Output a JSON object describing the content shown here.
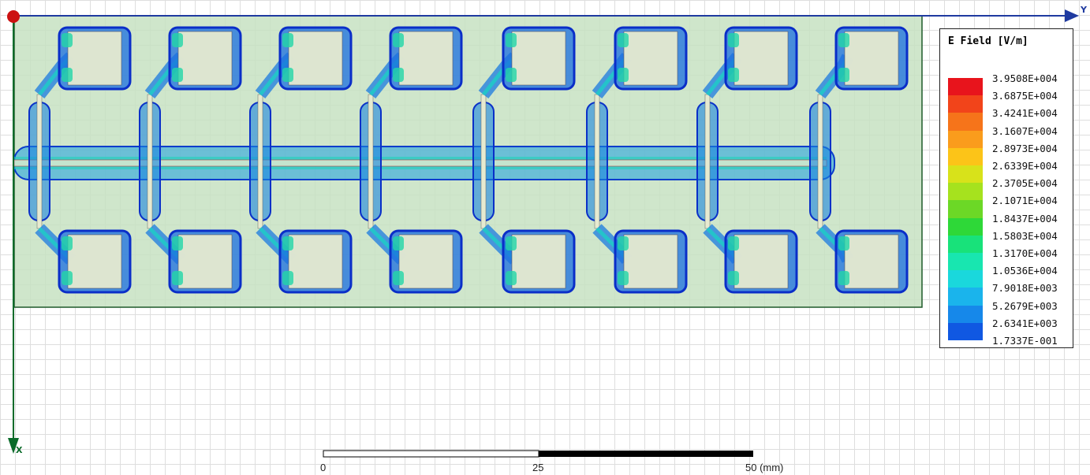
{
  "plot": {
    "axis_y_label": "Y",
    "axis_x_label": "X",
    "colors": {
      "substrate": "#c7e2c2",
      "trace": "#e6ead0",
      "axis_y": "#1f3aa0",
      "axis_x": "#0a6b2a",
      "origin": "#cc1111"
    }
  },
  "legend": {
    "title": "E Field [V/m]",
    "entries": [
      {
        "label": "3.9508E+004",
        "color": "#e8141c"
      },
      {
        "label": "3.6875E+004",
        "color": "#f2441a"
      },
      {
        "label": "3.4241E+004",
        "color": "#f6741a"
      },
      {
        "label": "3.1607E+004",
        "color": "#fa9c1c"
      },
      {
        "label": "2.8973E+004",
        "color": "#fcc418"
      },
      {
        "label": "2.6339E+004",
        "color": "#d8e21a"
      },
      {
        "label": "2.3705E+004",
        "color": "#a6e21e"
      },
      {
        "label": "2.1071E+004",
        "color": "#6cd826"
      },
      {
        "label": "1.8437E+004",
        "color": "#2ed838"
      },
      {
        "label": "1.5803E+004",
        "color": "#18e27a"
      },
      {
        "label": "1.3170E+004",
        "color": "#18e6b0"
      },
      {
        "label": "1.0536E+004",
        "color": "#1ad8dc"
      },
      {
        "label": "7.9018E+003",
        "color": "#1ab4ec"
      },
      {
        "label": "5.2679E+003",
        "color": "#1688ea"
      },
      {
        "label": "2.6341E+003",
        "color": "#1058e2"
      },
      {
        "label": "1.7337E-001",
        "color": "#0a2ed8"
      }
    ]
  },
  "scale_bar": {
    "labels": [
      "0",
      "25",
      "50 (mm)"
    ]
  }
}
